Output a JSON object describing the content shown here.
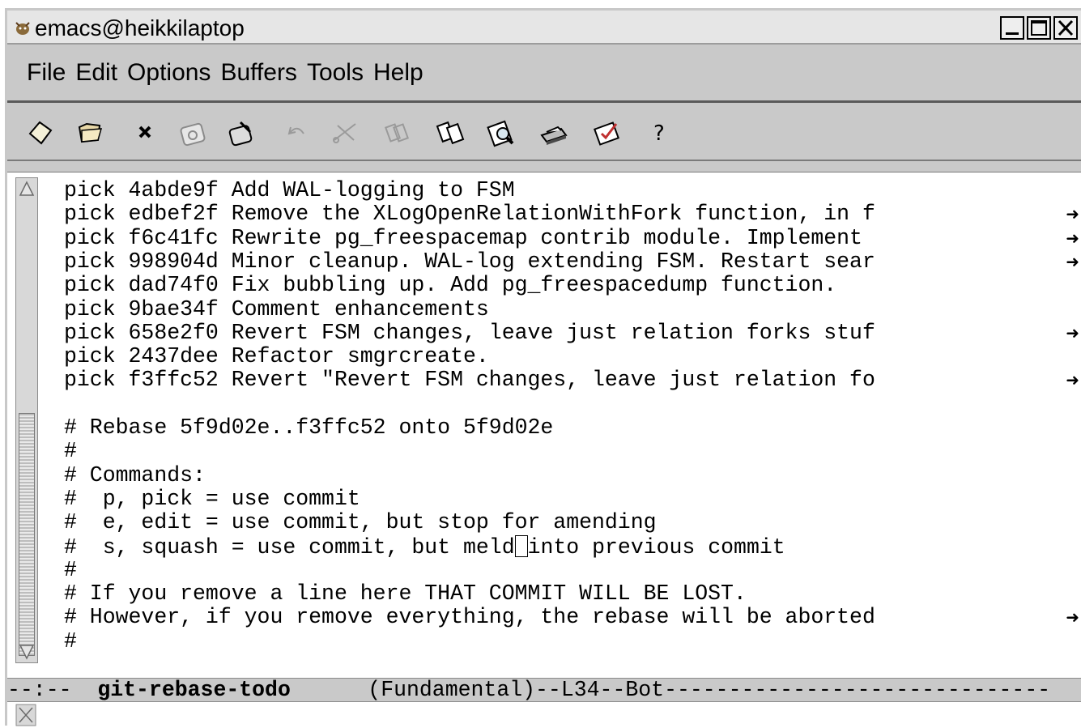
{
  "window": {
    "title": "emacs@heikkilaptop",
    "buttons": [
      "minimize",
      "maximize",
      "close"
    ]
  },
  "menubar": {
    "items": [
      "File",
      "Edit",
      "Options",
      "Buffers",
      "Tools",
      "Help"
    ]
  },
  "toolbar": {
    "icons": [
      "new-file-icon",
      "open-folder-icon",
      "close-buffer-icon",
      "save-icon",
      "save-as-icon",
      "undo-icon",
      "cut-icon",
      "copy-icon",
      "paste-icon",
      "search-icon",
      "print-icon",
      "spellcheck-icon",
      "help-icon"
    ],
    "help_glyph": "?"
  },
  "buffer": {
    "lines": [
      {
        "text": "pick 4abde9f Add WAL-logging to FSM",
        "truncated": false
      },
      {
        "text": "pick edbef2f Remove the XLogOpenRelationWithFork function, in f",
        "truncated": true
      },
      {
        "text": "pick f6c41fc Rewrite pg_freespacemap contrib module. Implement ",
        "truncated": true
      },
      {
        "text": "pick 998904d Minor cleanup. WAL-log extending FSM. Restart sear",
        "truncated": true
      },
      {
        "text": "pick dad74f0 Fix bubbling up. Add pg_freespacedump function.",
        "truncated": false
      },
      {
        "text": "pick 9bae34f Comment enhancements",
        "truncated": false
      },
      {
        "text": "pick 658e2f0 Revert FSM changes, leave just relation forks stuf",
        "truncated": true
      },
      {
        "text": "pick 2437dee Refactor smgrcreate.",
        "truncated": false
      },
      {
        "text": "pick f3ffc52 Revert \"Revert FSM changes, leave just relation fo",
        "truncated": true
      },
      {
        "text": "",
        "truncated": false
      },
      {
        "text": "# Rebase 5f9d02e..f3ffc52 onto 5f9d02e",
        "truncated": false
      },
      {
        "text": "#",
        "truncated": false
      },
      {
        "text": "# Commands:",
        "truncated": false
      },
      {
        "text": "#  p, pick = use commit",
        "truncated": false
      },
      {
        "text": "#  e, edit = use commit, but stop for amending",
        "truncated": false
      },
      {
        "text": "#  s, squash = use commit, but meld",
        "after_cursor": "into previous commit",
        "truncated": false,
        "cursor": true
      },
      {
        "text": "#",
        "truncated": false
      },
      {
        "text": "# If you remove a line here THAT COMMIT WILL BE LOST.",
        "truncated": false
      },
      {
        "text": "# However, if you remove everything, the rebase will be aborted",
        "truncated": true
      },
      {
        "text": "#",
        "truncated": false
      }
    ],
    "truncation_glyph": "➜"
  },
  "modeline": {
    "prefix": "--:--  ",
    "buffer_name": "git-rebase-todo",
    "gap": "      ",
    "mode": "(Fundamental)",
    "position": "--L34--Bot",
    "fill": "------------------------------"
  }
}
